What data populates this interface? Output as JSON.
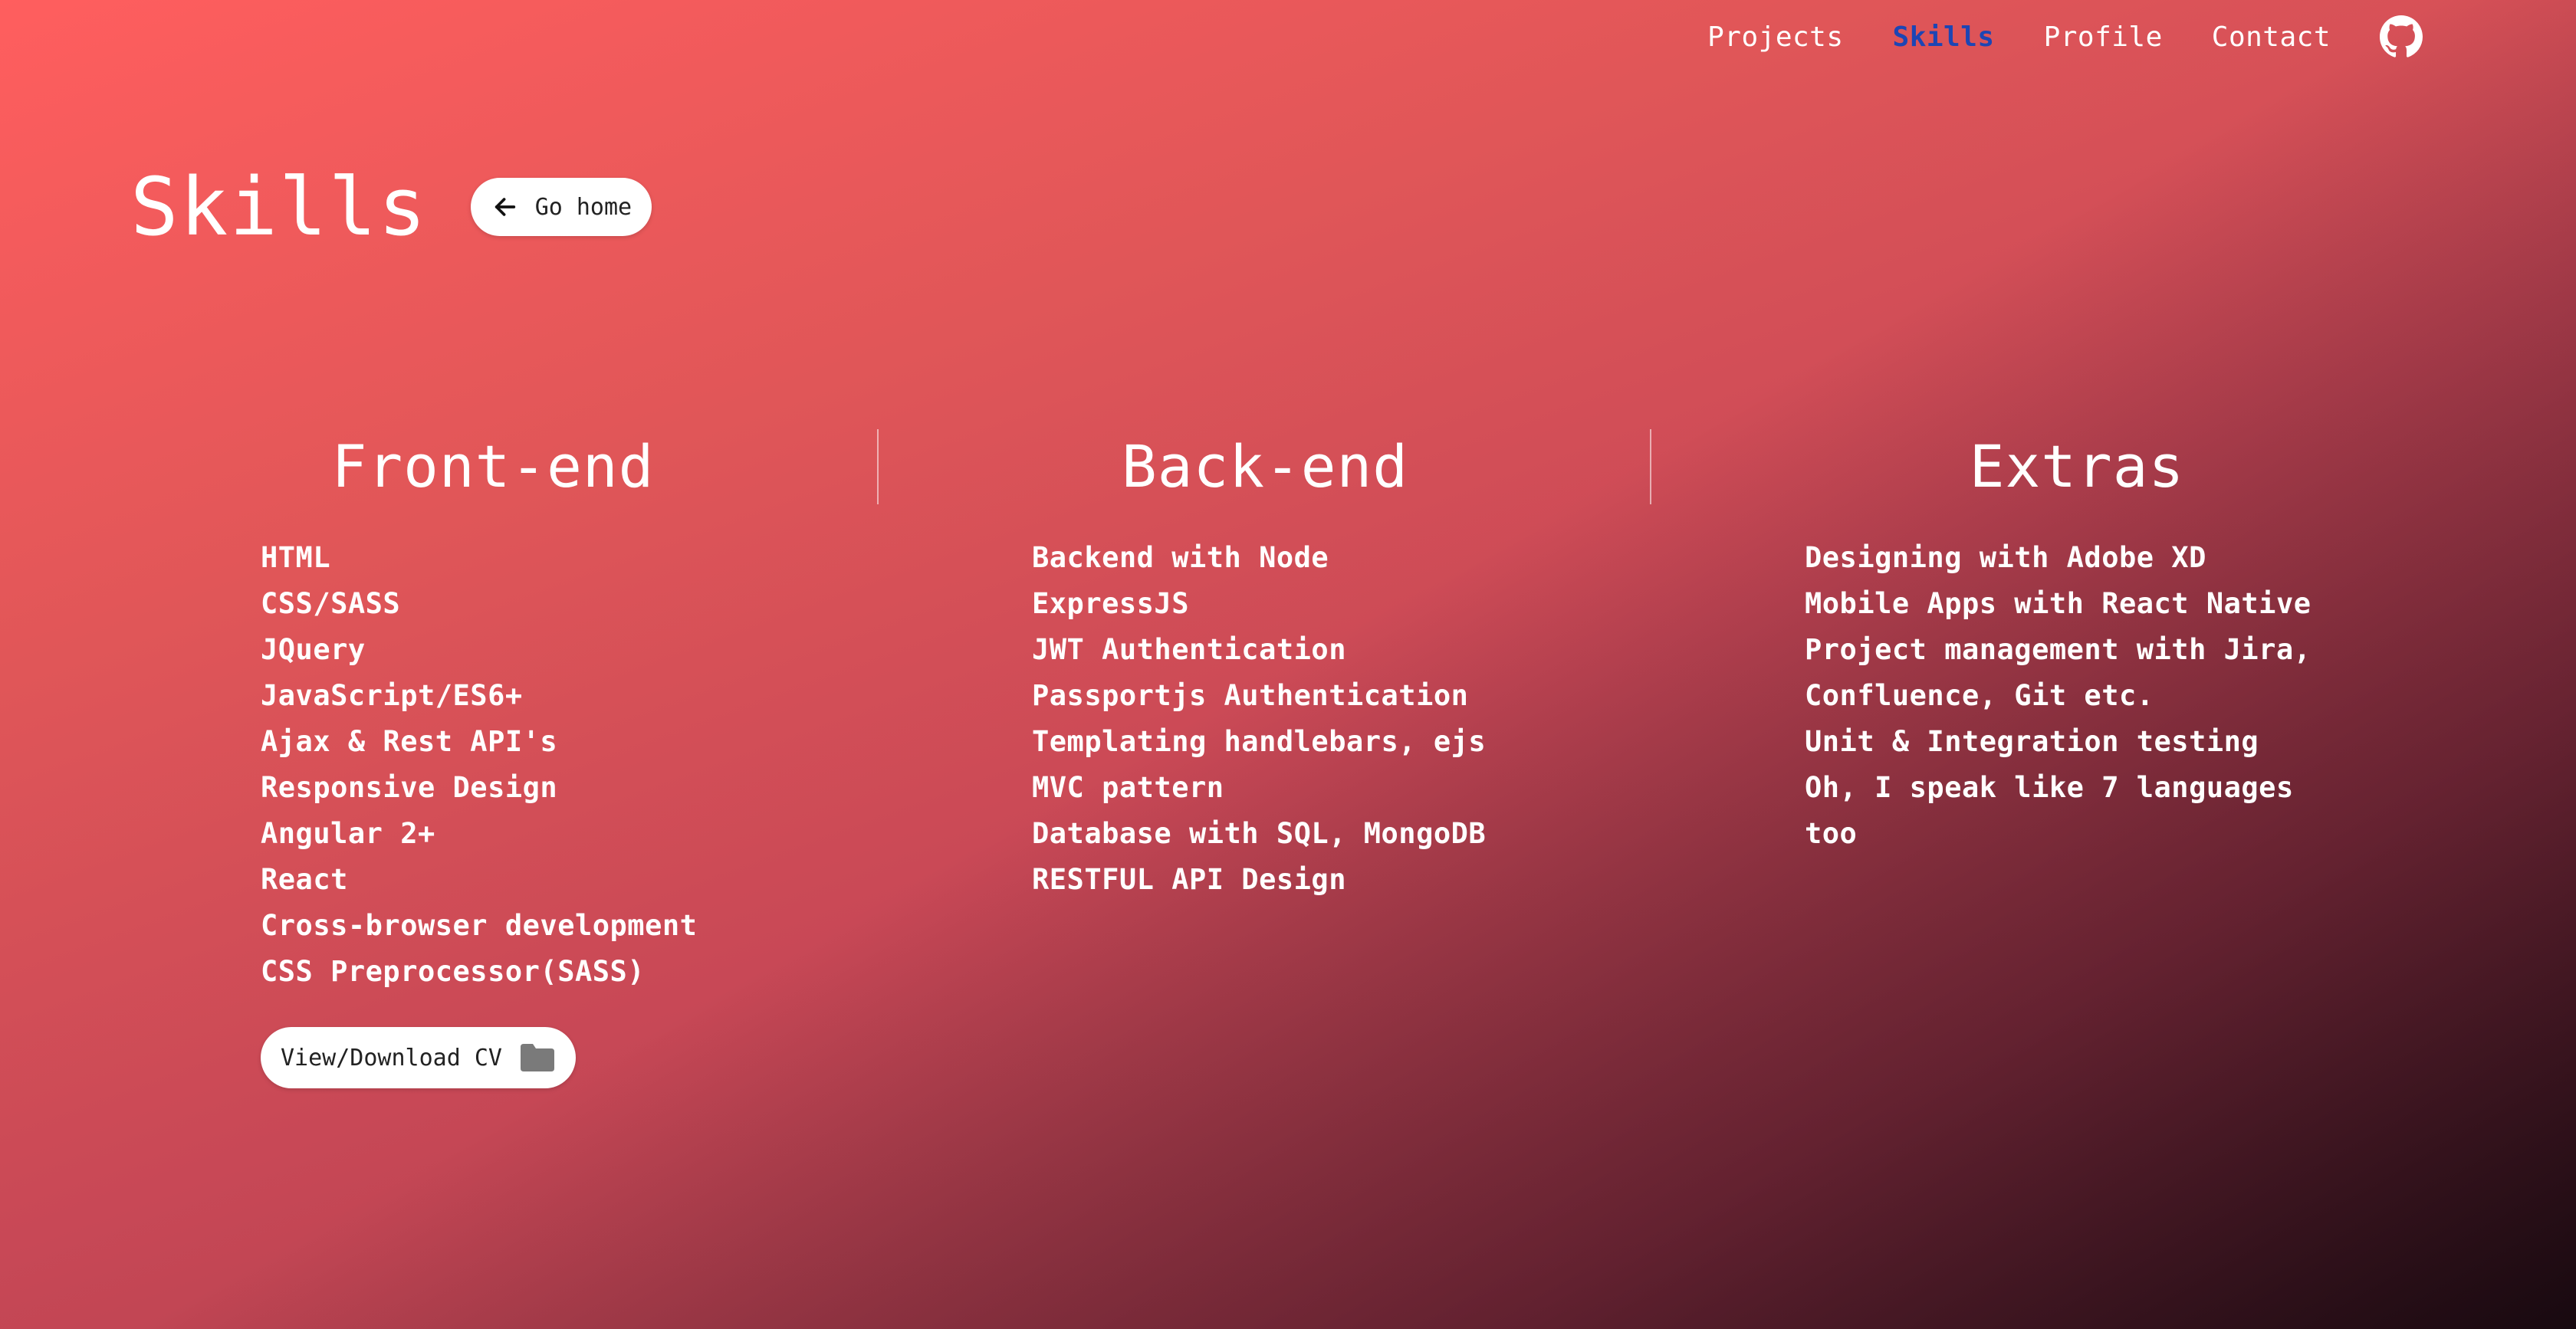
{
  "nav": {
    "links": [
      {
        "label": "Projects",
        "active": false
      },
      {
        "label": "Skills",
        "active": true
      },
      {
        "label": "Profile",
        "active": false
      },
      {
        "label": "Contact",
        "active": false
      }
    ],
    "github_icon": "github-icon"
  },
  "page": {
    "title": "Skills",
    "go_home_label": "Go home",
    "go_home_icon": "arrow-left-icon"
  },
  "columns": [
    {
      "title": "Front-end",
      "items": [
        "HTML",
        "CSS/SASS",
        "JQuery",
        "JavaScript/ES6+",
        "Ajax & Rest API's",
        "Responsive Design",
        "Angular 2+",
        "React",
        "Cross-browser development",
        "CSS Preprocessor(SASS)"
      ]
    },
    {
      "title": "Back-end",
      "items": [
        "Backend with Node",
        "ExpressJS",
        "JWT Authentication",
        "Passportjs Authentication",
        "Templating handlebars, ejs",
        "MVC pattern",
        "Database with SQL, MongoDB",
        "RESTFUL API Design"
      ]
    },
    {
      "title": "Extras",
      "items": [
        "Designing with Adobe XD",
        "Mobile Apps with React Native",
        "Project management with Jira, Confluence, Git etc.",
        "Unit & Integration testing",
        "Oh, I speak like 7 languages too"
      ]
    }
  ],
  "cv_button": {
    "label": "View/Download CV",
    "icon": "folder-icon"
  },
  "colors": {
    "gradient_start": "#ff5e5e",
    "gradient_end": "#1a0a10",
    "active_nav": "#1d45b4",
    "text": "#ffffff"
  }
}
